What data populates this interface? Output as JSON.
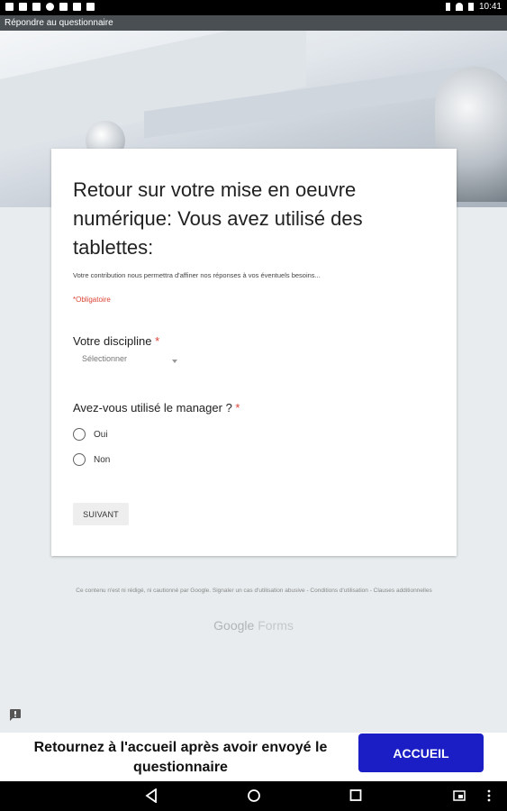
{
  "status_bar": {
    "time": "10:41"
  },
  "app_bar": {
    "title": "Répondre au questionnaire"
  },
  "form": {
    "title": "Retour sur votre mise en oeuvre numérique: Vous avez utilisé des tablettes:",
    "description": "Votre contribution nous permettra d'affiner nos réponses à vos éventuels besoins...",
    "required_note": "*Obligatoire",
    "q1": {
      "label": "Votre discipline",
      "star": "*",
      "select_value": "Sélectionner"
    },
    "q2": {
      "label": "Avez-vous utilisé le manager ?",
      "star": "*",
      "options": [
        "Oui",
        "Non"
      ]
    },
    "next_label": "SUIVANT"
  },
  "footer": {
    "text": "Ce contenu n'est ni rédigé, ni cautionné par Google. Signaler un cas d'utilisation abusive - Conditions d'utilisation - Clauses additionnelles",
    "brand_google": "Google",
    "brand_forms": "Forms"
  },
  "bottom": {
    "message": "Retournez à l'accueil après avoir envoyé le questionnaire",
    "button_label": "ACCUEIL"
  },
  "colors": {
    "accent": "#1a1ec4",
    "required": "#db4437"
  }
}
